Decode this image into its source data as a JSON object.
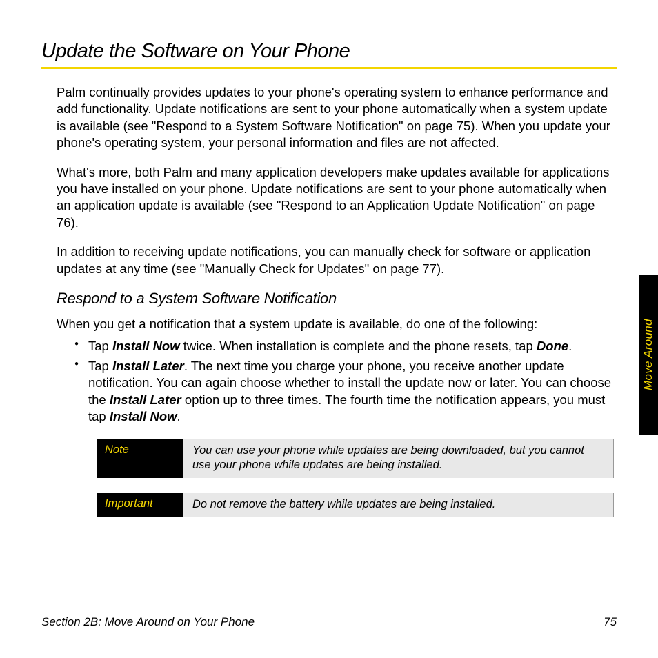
{
  "title": "Update the Software on Your Phone",
  "para1": "Palm continually provides updates to your phone's operating system to enhance performance and add functionality. Update notifications are sent to your phone automatically when a system update is available (see \"Respond to a System Software Notification\" on page 75). When you update your phone's operating system, your personal information and files are not affected.",
  "para2": "What's more, both Palm and many application developers make updates available for applications you have installed on your phone. Update notifications are sent to your phone automatically when an application update is available (see \"Respond to an Application Update Notification\" on page 76).",
  "para3": "In addition to receiving update notifications, you can manually check for software or application updates at any time (see \"Manually Check for Updates\" on page 77).",
  "subhead": "Respond to a System Software Notification",
  "lead": "When you get a notification that a system update is available, do one of the following:",
  "bullet1": {
    "pre": "Tap ",
    "em1": "Install Now",
    "mid": " twice. When installation is complete and the phone resets, tap ",
    "em2": "Done",
    "post": "."
  },
  "bullet2": {
    "pre": "Tap ",
    "em1": "Install Later",
    "mid": ". The next time you charge your phone, you receive another update notification. You can again choose whether to install the update now or later. You can choose the ",
    "em2": "Install Later",
    "mid2": " option up to three times. The fourth time the notification appears, you must tap ",
    "em3": "Install Now",
    "post": "."
  },
  "note": {
    "label": "Note",
    "text": "You can use your phone while updates are being downloaded, but you cannot use your phone while updates are being installed."
  },
  "important": {
    "label": "Important",
    "text": "Do not remove the battery while updates are being installed."
  },
  "sideTab": "Move Around",
  "footer": {
    "section": "Section 2B: Move Around on Your Phone",
    "page": "75"
  }
}
